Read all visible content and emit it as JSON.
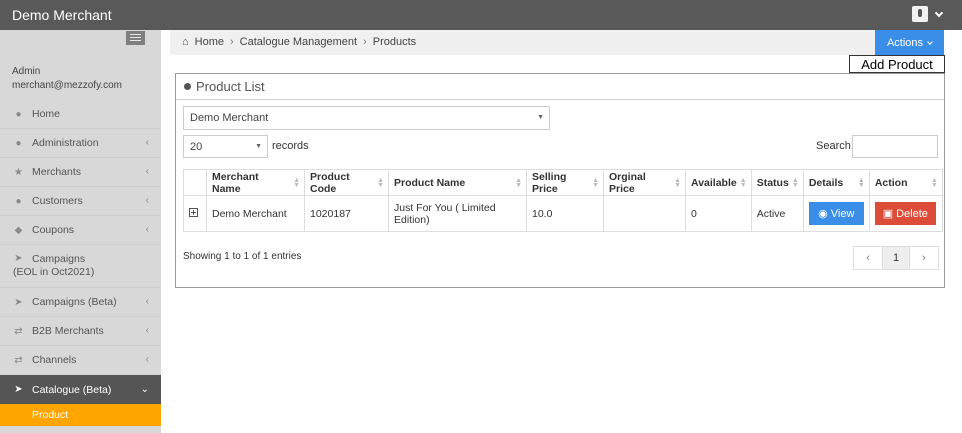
{
  "app": {
    "brand": "Demo Merchant"
  },
  "user": {
    "role": "Admin",
    "email": "merchant@mezzofy.com"
  },
  "sidebar": {
    "items": [
      {
        "label": "Home",
        "icon": "globe-icon"
      },
      {
        "label": "Administration",
        "icon": "user-icon"
      },
      {
        "label": "Merchants",
        "icon": "star-icon"
      },
      {
        "label": "Customers",
        "icon": "users-icon"
      },
      {
        "label": "Coupons",
        "icon": "tag-icon"
      },
      {
        "label_line1": "Campaigns",
        "label_line2": "(EOL in Oct2021)",
        "icon": "rocket-icon"
      },
      {
        "label": "Campaigns (Beta)",
        "icon": "rocket-icon"
      },
      {
        "label": "B2B Merchants",
        "icon": "exchange-icon"
      },
      {
        "label": "Channels",
        "icon": "exchange-icon"
      },
      {
        "label": "Catalogue (Beta)",
        "icon": "rocket-icon"
      }
    ],
    "subitem": "Product"
  },
  "breadcrumb": {
    "home": "Home",
    "section": "Catalogue Management",
    "page": "Products"
  },
  "actions": {
    "label": "Actions",
    "menu_item": "Add Product"
  },
  "panel": {
    "title": "Product List",
    "merchant_filter": "Demo Merchant",
    "page_length": "20",
    "records_label": "records",
    "search_label": "Search:"
  },
  "table": {
    "headers": [
      "Merchant Name",
      "Product Code",
      "Product Name",
      "Selling Price",
      "Orginal Price",
      "Available",
      "Status",
      "Details",
      "Action"
    ],
    "rows": [
      {
        "merchant": "Demo Merchant",
        "code": "1020187",
        "name": "Just For You ( Limited Edition)",
        "selling_price": "10.0",
        "original_price": "",
        "available": "0",
        "status": "Active",
        "view_label": "View",
        "delete_label": "Delete"
      }
    ]
  },
  "footer": {
    "info": "Showing 1 to 1 of 1 entries",
    "current_page": "1"
  }
}
